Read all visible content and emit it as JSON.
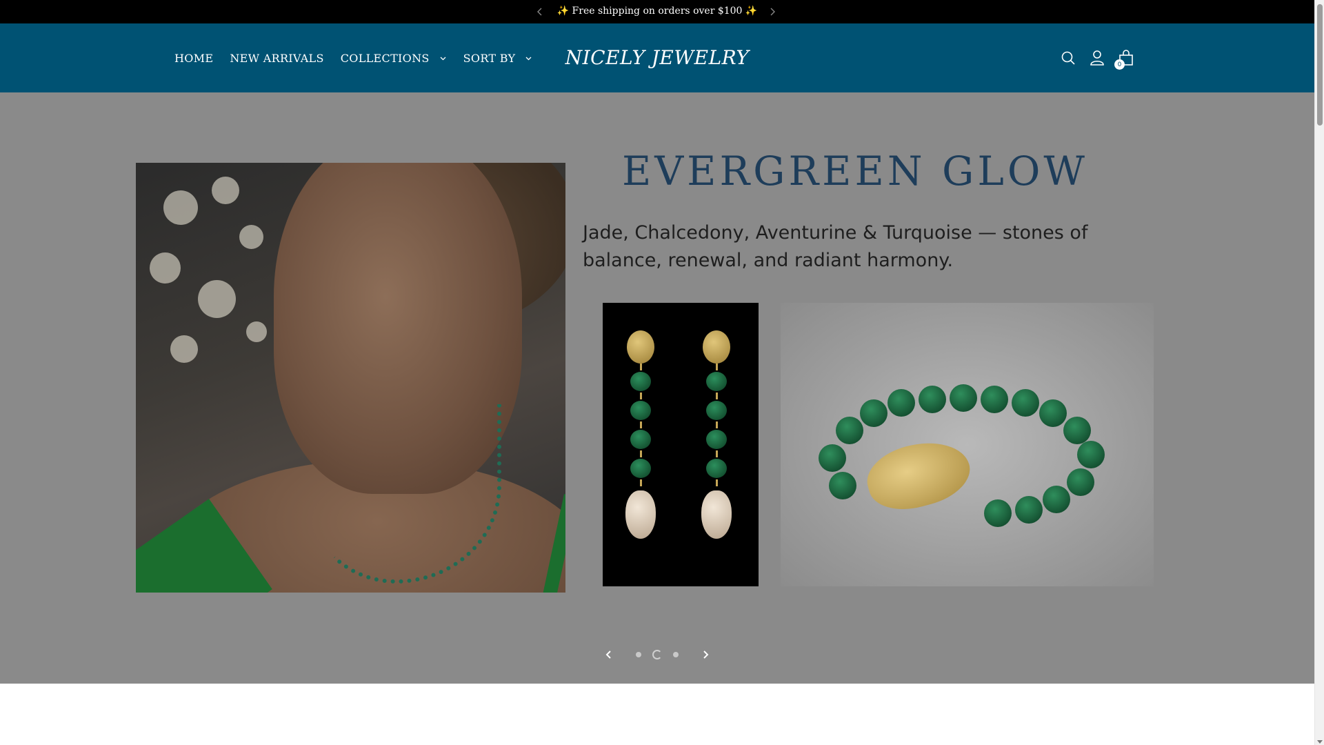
{
  "announcement": {
    "text": "✨ Free shipping on orders over $100 ✨",
    "prev_icon": "chevron-left-icon",
    "next_icon": "chevron-right-icon"
  },
  "header": {
    "background": "#005273",
    "nav": [
      {
        "label": "HOME",
        "has_dropdown": false
      },
      {
        "label": "NEW ARRIVALS",
        "has_dropdown": false
      },
      {
        "label": "COLLECTIONS",
        "has_dropdown": true
      },
      {
        "label": "SORT BY",
        "has_dropdown": true
      }
    ],
    "logo": "NICELY JEWELRY",
    "icons": [
      "search-icon",
      "account-icon",
      "bag-icon"
    ],
    "cart_count": "0"
  },
  "hero": {
    "headline": "EVERGREEN GLOW",
    "subline": "Jade, Chalcedony, Aventurine & Turquoise — stones of balance, renewal, and radiant harmony.",
    "headline_color": "#1e3d5a",
    "slide_count": 3,
    "active_slide": 2
  }
}
